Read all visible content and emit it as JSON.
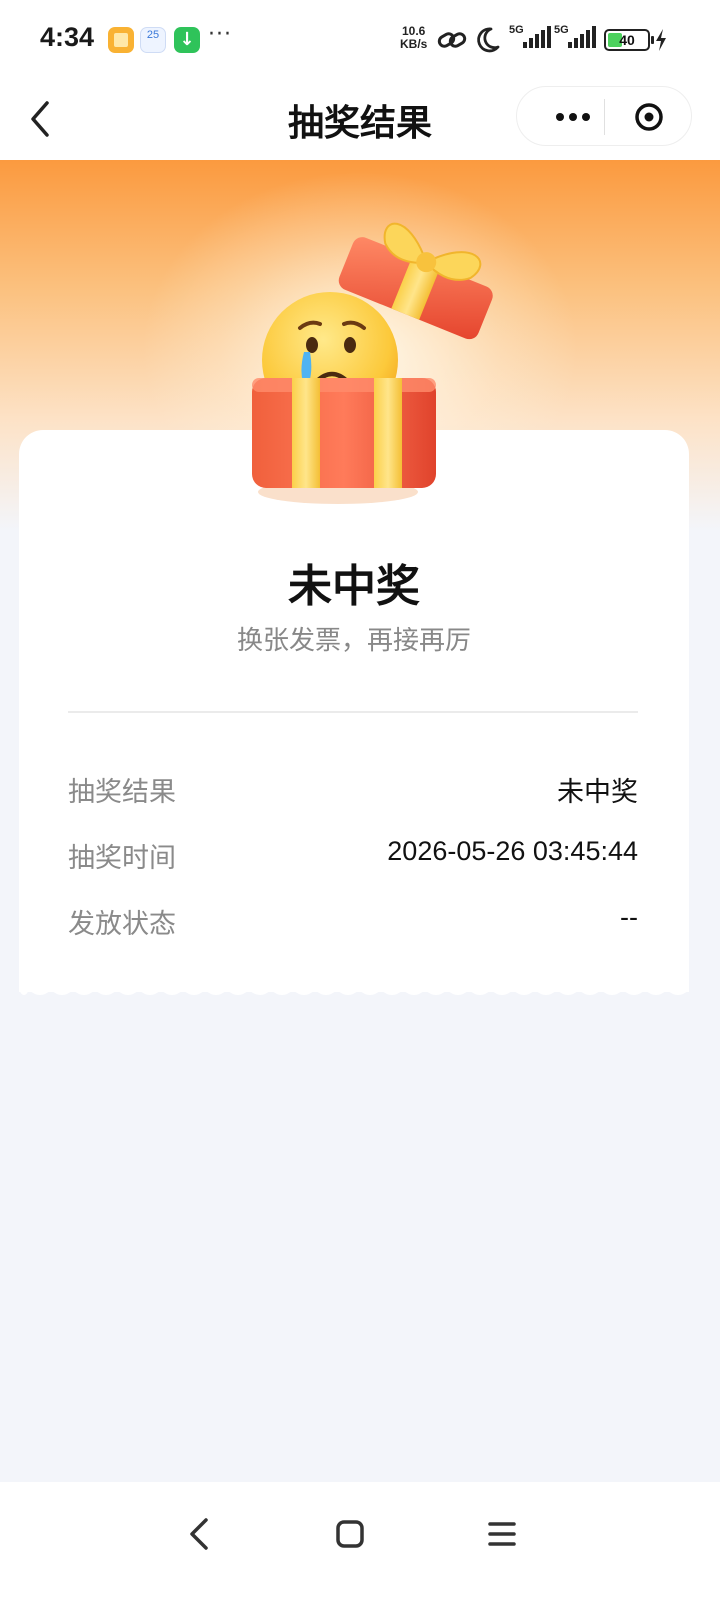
{
  "status_bar": {
    "time": "4:34",
    "calendar_day": "25",
    "more": "···",
    "net_speed_value": "10.6",
    "net_speed_unit": "KB/s",
    "signal1": "5G",
    "signal2": "5G",
    "battery_level": "40"
  },
  "nav": {
    "title": "抽奖结果"
  },
  "result": {
    "title": "未中奖",
    "subtitle": "换张发票，再接再厉"
  },
  "details": [
    {
      "label": "抽奖结果",
      "value": "未中奖"
    },
    {
      "label": "抽奖时间",
      "value": "2026-05-26 03:45:44"
    },
    {
      "label": "发放状态",
      "value": "--"
    }
  ],
  "colors": {
    "hero_top": "#fb9a3f",
    "gift_red": "#f2543f",
    "ribbon_yellow": "#fcd65a",
    "page_bg": "#f3f5fa"
  }
}
